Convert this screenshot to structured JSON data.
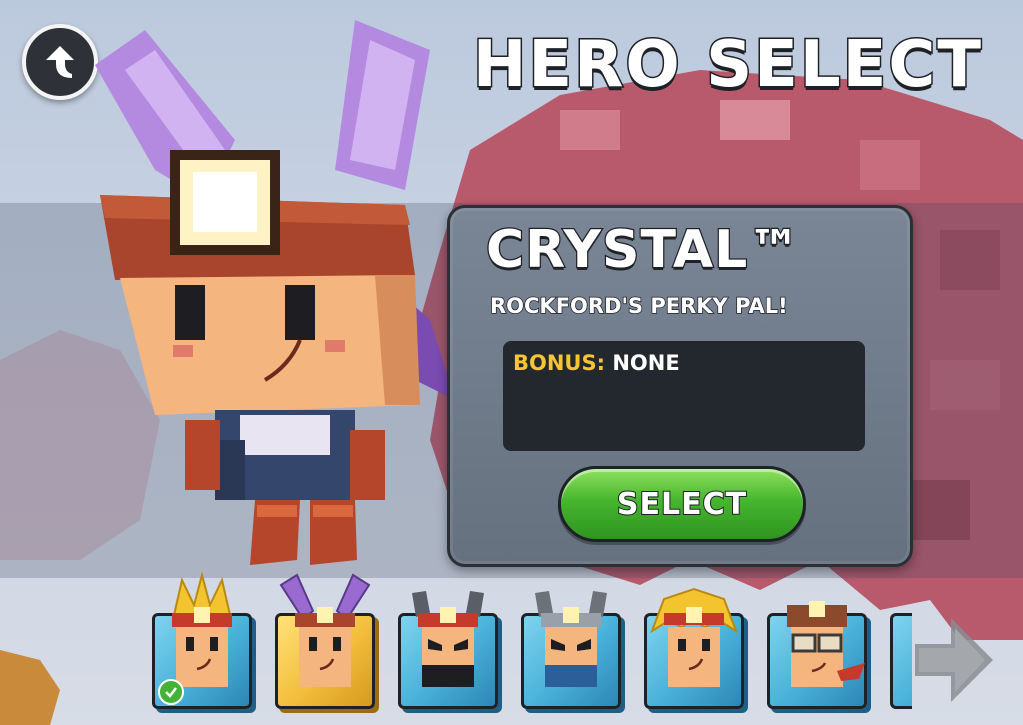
{
  "header": {
    "title": "HERO SELECT",
    "back_icon": "back-arrow-icon"
  },
  "hero": {
    "name": "CRYSTAL™",
    "tagline": "ROCKFORD'S PERKY PAL!",
    "bonus_label": "BONUS:",
    "bonus_value": "NONE",
    "select_label": "SELECT"
  },
  "roster": [
    {
      "id": "crown-hero",
      "owned": true,
      "selected": false,
      "hair": "#f4c430"
    },
    {
      "id": "crystal",
      "owned": false,
      "selected": true,
      "hair": "#9a6ad0"
    },
    {
      "id": "horned-red",
      "owned": false,
      "selected": false,
      "hair": "#5a5e66"
    },
    {
      "id": "horned-blue",
      "owned": false,
      "selected": false,
      "hair": "#6d7179"
    },
    {
      "id": "blonde-hero",
      "owned": false,
      "selected": false,
      "hair": "#f4c430"
    },
    {
      "id": "goggles-hero",
      "owned": false,
      "selected": false,
      "hair": "#8b4a2b"
    }
  ],
  "colors": {
    "panel": "#6f7a88",
    "bonus_label": "#f7c531",
    "select_button": "#46b62e",
    "card_blue": "#47b0d8",
    "card_gold": "#f2bd3a"
  }
}
